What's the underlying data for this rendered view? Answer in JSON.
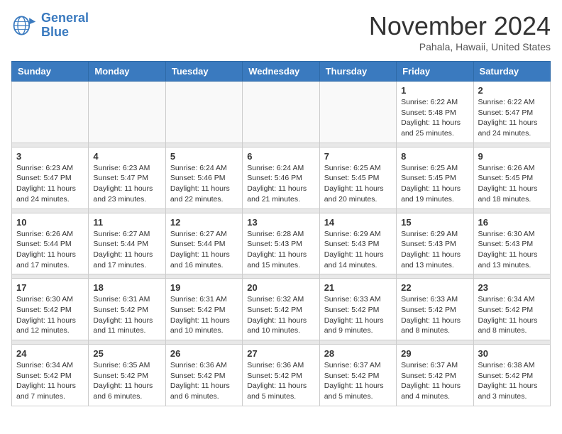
{
  "header": {
    "logo_line1": "General",
    "logo_line2": "Blue",
    "month": "November 2024",
    "location": "Pahala, Hawaii, United States"
  },
  "days_of_week": [
    "Sunday",
    "Monday",
    "Tuesday",
    "Wednesday",
    "Thursday",
    "Friday",
    "Saturday"
  ],
  "weeks": [
    [
      {
        "day": "",
        "info": ""
      },
      {
        "day": "",
        "info": ""
      },
      {
        "day": "",
        "info": ""
      },
      {
        "day": "",
        "info": ""
      },
      {
        "day": "",
        "info": ""
      },
      {
        "day": "1",
        "info": "Sunrise: 6:22 AM\nSunset: 5:48 PM\nDaylight: 11 hours and 25 minutes."
      },
      {
        "day": "2",
        "info": "Sunrise: 6:22 AM\nSunset: 5:47 PM\nDaylight: 11 hours and 24 minutes."
      }
    ],
    [
      {
        "day": "3",
        "info": "Sunrise: 6:23 AM\nSunset: 5:47 PM\nDaylight: 11 hours and 24 minutes."
      },
      {
        "day": "4",
        "info": "Sunrise: 6:23 AM\nSunset: 5:47 PM\nDaylight: 11 hours and 23 minutes."
      },
      {
        "day": "5",
        "info": "Sunrise: 6:24 AM\nSunset: 5:46 PM\nDaylight: 11 hours and 22 minutes."
      },
      {
        "day": "6",
        "info": "Sunrise: 6:24 AM\nSunset: 5:46 PM\nDaylight: 11 hours and 21 minutes."
      },
      {
        "day": "7",
        "info": "Sunrise: 6:25 AM\nSunset: 5:45 PM\nDaylight: 11 hours and 20 minutes."
      },
      {
        "day": "8",
        "info": "Sunrise: 6:25 AM\nSunset: 5:45 PM\nDaylight: 11 hours and 19 minutes."
      },
      {
        "day": "9",
        "info": "Sunrise: 6:26 AM\nSunset: 5:45 PM\nDaylight: 11 hours and 18 minutes."
      }
    ],
    [
      {
        "day": "10",
        "info": "Sunrise: 6:26 AM\nSunset: 5:44 PM\nDaylight: 11 hours and 17 minutes."
      },
      {
        "day": "11",
        "info": "Sunrise: 6:27 AM\nSunset: 5:44 PM\nDaylight: 11 hours and 17 minutes."
      },
      {
        "day": "12",
        "info": "Sunrise: 6:27 AM\nSunset: 5:44 PM\nDaylight: 11 hours and 16 minutes."
      },
      {
        "day": "13",
        "info": "Sunrise: 6:28 AM\nSunset: 5:43 PM\nDaylight: 11 hours and 15 minutes."
      },
      {
        "day": "14",
        "info": "Sunrise: 6:29 AM\nSunset: 5:43 PM\nDaylight: 11 hours and 14 minutes."
      },
      {
        "day": "15",
        "info": "Sunrise: 6:29 AM\nSunset: 5:43 PM\nDaylight: 11 hours and 13 minutes."
      },
      {
        "day": "16",
        "info": "Sunrise: 6:30 AM\nSunset: 5:43 PM\nDaylight: 11 hours and 13 minutes."
      }
    ],
    [
      {
        "day": "17",
        "info": "Sunrise: 6:30 AM\nSunset: 5:42 PM\nDaylight: 11 hours and 12 minutes."
      },
      {
        "day": "18",
        "info": "Sunrise: 6:31 AM\nSunset: 5:42 PM\nDaylight: 11 hours and 11 minutes."
      },
      {
        "day": "19",
        "info": "Sunrise: 6:31 AM\nSunset: 5:42 PM\nDaylight: 11 hours and 10 minutes."
      },
      {
        "day": "20",
        "info": "Sunrise: 6:32 AM\nSunset: 5:42 PM\nDaylight: 11 hours and 10 minutes."
      },
      {
        "day": "21",
        "info": "Sunrise: 6:33 AM\nSunset: 5:42 PM\nDaylight: 11 hours and 9 minutes."
      },
      {
        "day": "22",
        "info": "Sunrise: 6:33 AM\nSunset: 5:42 PM\nDaylight: 11 hours and 8 minutes."
      },
      {
        "day": "23",
        "info": "Sunrise: 6:34 AM\nSunset: 5:42 PM\nDaylight: 11 hours and 8 minutes."
      }
    ],
    [
      {
        "day": "24",
        "info": "Sunrise: 6:34 AM\nSunset: 5:42 PM\nDaylight: 11 hours and 7 minutes."
      },
      {
        "day": "25",
        "info": "Sunrise: 6:35 AM\nSunset: 5:42 PM\nDaylight: 11 hours and 6 minutes."
      },
      {
        "day": "26",
        "info": "Sunrise: 6:36 AM\nSunset: 5:42 PM\nDaylight: 11 hours and 6 minutes."
      },
      {
        "day": "27",
        "info": "Sunrise: 6:36 AM\nSunset: 5:42 PM\nDaylight: 11 hours and 5 minutes."
      },
      {
        "day": "28",
        "info": "Sunrise: 6:37 AM\nSunset: 5:42 PM\nDaylight: 11 hours and 5 minutes."
      },
      {
        "day": "29",
        "info": "Sunrise: 6:37 AM\nSunset: 5:42 PM\nDaylight: 11 hours and 4 minutes."
      },
      {
        "day": "30",
        "info": "Sunrise: 6:38 AM\nSunset: 5:42 PM\nDaylight: 11 hours and 3 minutes."
      }
    ]
  ]
}
